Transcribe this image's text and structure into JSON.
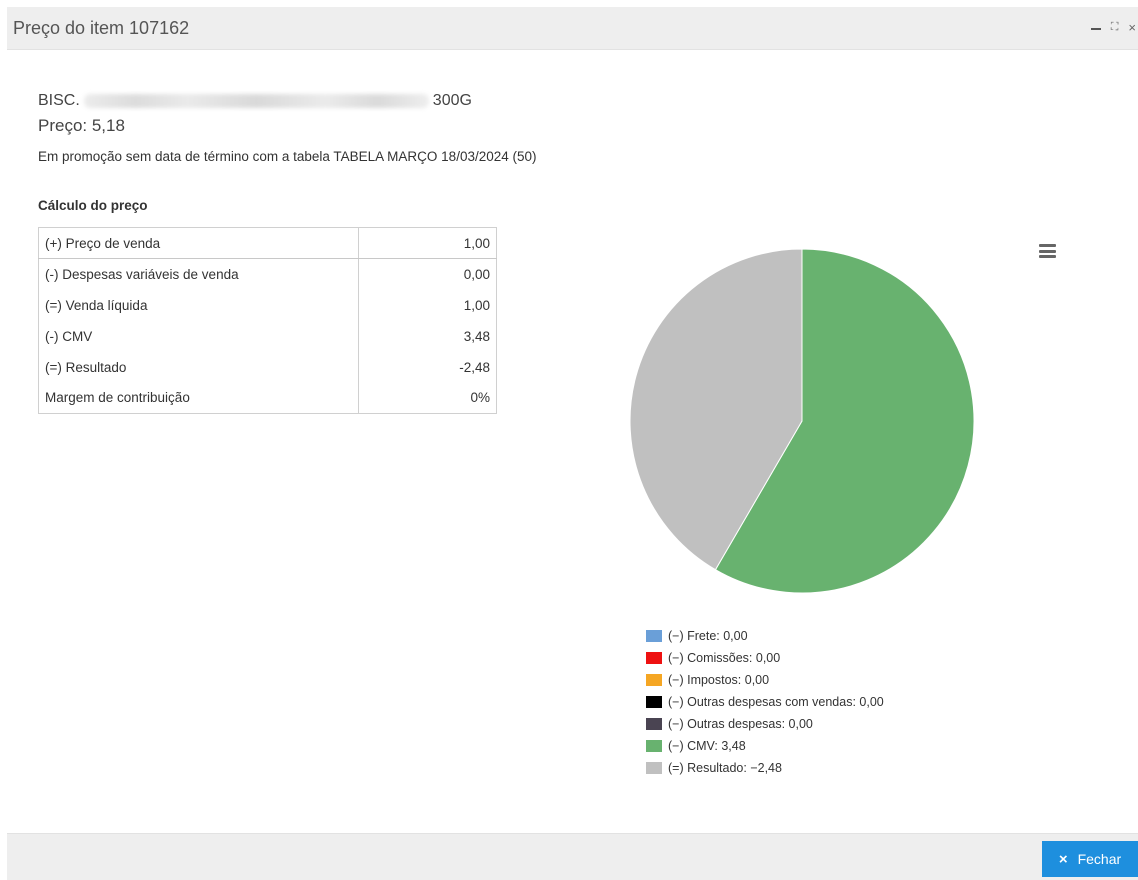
{
  "window": {
    "title": "Preço do item 107162",
    "controls": {
      "minimize": "−",
      "maximize": "⛶",
      "close": "×"
    }
  },
  "product": {
    "name_prefix": "BISC.",
    "name_suffix": "300G",
    "price": "Preço: 5,18",
    "promo": "Em promoção sem data de término com a tabela TABELA MARÇO 18/03/2024 (50)"
  },
  "calculation": {
    "title": "Cálculo do preço",
    "rows": [
      {
        "label": "(+) Preço de venda",
        "value": "1,00"
      },
      {
        "label": "(-) Despesas variáveis de venda",
        "value": "0,00"
      },
      {
        "label": "(=) Venda líquida",
        "value": "1,00"
      },
      {
        "label": "(-) CMV",
        "value": "3,48"
      },
      {
        "label": "(=) Resultado",
        "value": "-2,48"
      },
      {
        "label": "Margem de contribuição",
        "value": "0%"
      }
    ]
  },
  "chart_data": {
    "type": "pie",
    "slices": [
      {
        "label": "(−) Frete: 0,00",
        "value": 0,
        "color": "#6a9fd8"
      },
      {
        "label": "(−) Comissões: 0,00",
        "value": 0,
        "color": "#ee1111"
      },
      {
        "label": "(−) Impostos: 0,00",
        "value": 0,
        "color": "#f5a623"
      },
      {
        "label": "(−) Outras despesas com vendas: 0,00",
        "value": 0,
        "color": "#000000"
      },
      {
        "label": "(−) Outras despesas: 0,00",
        "value": 0,
        "color": "#4a4452"
      },
      {
        "label": "(−) CMV: 3,48",
        "value": 3.48,
        "color": "#68b26f"
      },
      {
        "label": "(=) Resultado: −2,48",
        "value": 2.48,
        "color": "#c0c0c0"
      }
    ],
    "legend_position": "bottom"
  },
  "footer": {
    "close_label": "Fechar",
    "close_icon": "×"
  }
}
